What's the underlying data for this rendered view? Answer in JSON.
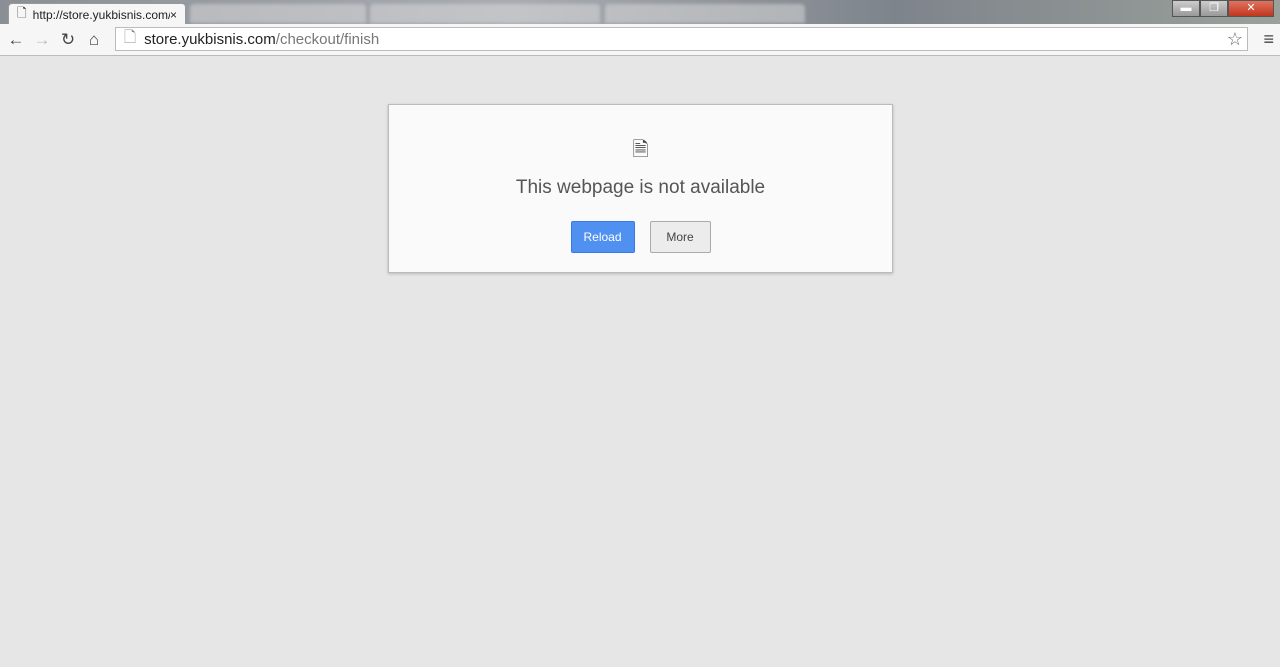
{
  "tab": {
    "title": "http://store.yukbisnis.com/checkout/finish",
    "close": "×"
  },
  "window": {
    "minimize": "▬",
    "restore": "❐",
    "close": "✕"
  },
  "toolbar": {
    "back": "←",
    "forward": "→",
    "reload": "↻",
    "home": "⌂",
    "star": "☆",
    "menu": "≡"
  },
  "omnibox": {
    "host": "store.yukbisnis.com",
    "path": "/checkout/finish"
  },
  "error": {
    "icon": "sad-page-icon",
    "message": "This webpage is not available",
    "reload_label": "Reload",
    "more_label": "More"
  },
  "colors": {
    "reload_button": "#5090f0",
    "background": "#e6e6e6"
  }
}
